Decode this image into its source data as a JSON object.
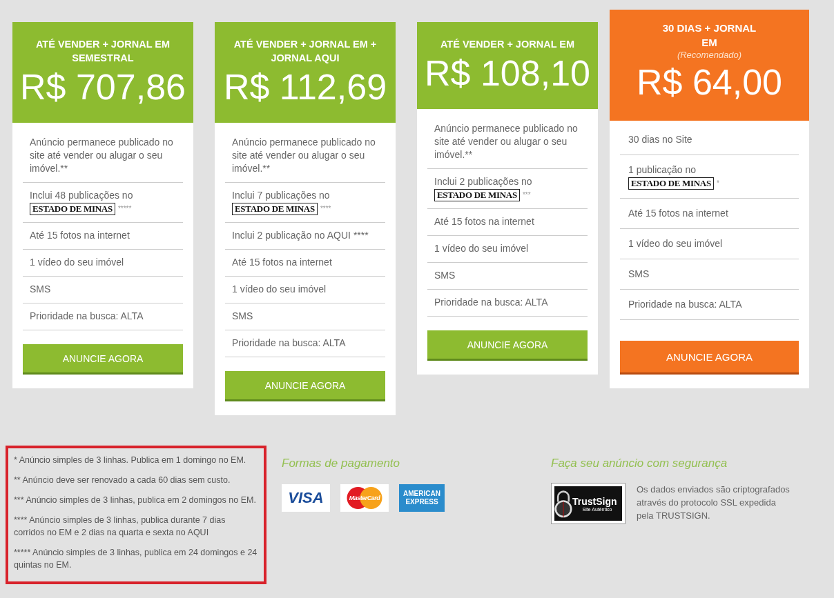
{
  "plans": [
    {
      "title": "ATÉ VENDER + JORNAL EM SEMESTRAL",
      "recommended": false,
      "price": "R$ 707,86",
      "features": [
        {
          "text": "Anúncio permanece publicado no site até vender ou alugar o seu imóvel.**"
        },
        {
          "text": "Inclui 48 publicações no",
          "logo": "ESTADO DE MINAS",
          "mark": "*****"
        },
        {
          "text": "Até 15 fotos na internet"
        },
        {
          "text": "1 vídeo do seu imóvel"
        },
        {
          "text": "SMS"
        },
        {
          "text": "Prioridade na busca: ALTA"
        }
      ],
      "button": "ANUNCIE AGORA"
    },
    {
      "title": "ATÉ VENDER + JORNAL EM + JORNAL AQUI",
      "recommended": false,
      "price": "R$ 112,69",
      "features": [
        {
          "text": "Anúncio permanece publicado no site até vender ou alugar o seu imóvel.**"
        },
        {
          "text": "Inclui 7 publicações no",
          "logo": "ESTADO DE MINAS",
          "mark": "****"
        },
        {
          "text": "Inclui 2 publicação no AQUI ****"
        },
        {
          "text": "Até 15 fotos na internet"
        },
        {
          "text": "1 vídeo do seu imóvel"
        },
        {
          "text": "SMS"
        },
        {
          "text": "Prioridade na busca: ALTA"
        }
      ],
      "button": "ANUNCIE AGORA"
    },
    {
      "title": "ATÉ VENDER + JORNAL EM",
      "recommended": false,
      "price": "R$ 108,10",
      "features": [
        {
          "text": "Anúncio permanece publicado no site até vender ou alugar o seu imóvel.**"
        },
        {
          "text": "Inclui 2 publicações no",
          "logo": "ESTADO DE MINAS",
          "mark": "***"
        },
        {
          "text": "Até 15 fotos na internet"
        },
        {
          "text": "1 vídeo do seu imóvel"
        },
        {
          "text": "SMS"
        },
        {
          "text": "Prioridade na busca: ALTA"
        }
      ],
      "button": "ANUNCIE AGORA"
    },
    {
      "title": "30 DIAS + JORNAL EM",
      "subtitle": "(Recomendado)",
      "recommended": true,
      "price": "R$ 64,00",
      "features": [
        {
          "text": "30 dias no Site"
        },
        {
          "text": "1 publicação no",
          "logo": "ESTADO DE MINAS",
          "mark": "*"
        },
        {
          "text": "Até 15 fotos na internet"
        },
        {
          "text": "1 vídeo do seu imóvel"
        },
        {
          "text": "SMS"
        },
        {
          "text": "Prioridade na busca: ALTA"
        }
      ],
      "button": "ANUNCIE AGORA"
    }
  ],
  "footnotes": [
    "* Anúncio simples de 3 linhas. Publica em 1 domingo no EM.",
    "** Anúncio deve ser renovado a cada 60 dias sem custo.",
    "*** Anúncio simples de 3 linhas, publica em 2 domingos no EM.",
    "**** Anúncio simples de 3 linhas, publica durante 7 dias corridos no EM e 2 dias na quarta e sexta no AQUI",
    "***** Anúncio simples de 3 linhas, publica em 24 domingos e 24 quintas no EM."
  ],
  "payment": {
    "title": "Formas de pagamento",
    "cards": [
      {
        "kind": "visa",
        "label": "VISA"
      },
      {
        "kind": "mastercard",
        "label": "MasterCard"
      },
      {
        "kind": "amex",
        "label": "AMERICAN EXPRESS"
      }
    ]
  },
  "security": {
    "title": "Faça seu anúncio com segurança",
    "seal": {
      "name": "TrustSign",
      "tagline": "Site Autêntico"
    },
    "text": "Os dados enviados são criptografados através do protocolo SSL expedida pela TRUSTSIGN."
  }
}
